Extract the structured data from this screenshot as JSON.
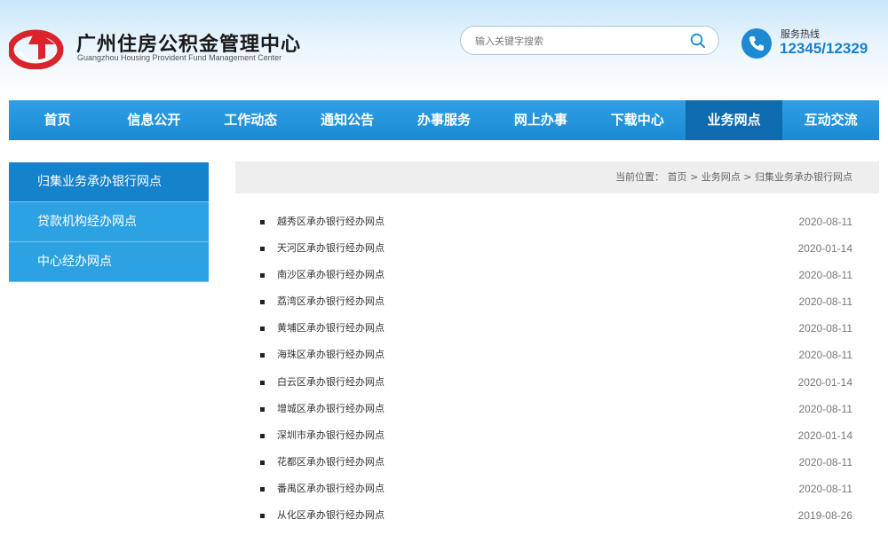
{
  "header": {
    "title": "广州住房公积金管理中心",
    "subtitle": "Guangzhou Housing Provident Fund Management Center",
    "logo_icon": "guangzhou-hpf-logo",
    "search": {
      "placeholder": "输入关键字搜索",
      "value": ""
    },
    "hotline": {
      "label": "服务热线",
      "number": "12345/12329"
    }
  },
  "colors": {
    "nav_blue": "#1b8ad4",
    "nav_active": "#0e6cae",
    "side_blue": "#2ca2e3",
    "side_active": "#1582cc",
    "logo_red": "#d8242a",
    "hotline_blue": "#1a7fcc"
  },
  "nav": {
    "items": [
      {
        "label": "首页"
      },
      {
        "label": "信息公开"
      },
      {
        "label": "工作动态"
      },
      {
        "label": "通知公告"
      },
      {
        "label": "办事服务"
      },
      {
        "label": "网上办事"
      },
      {
        "label": "下载中心"
      },
      {
        "label": "业务网点",
        "active": true
      },
      {
        "label": "互动交流"
      }
    ]
  },
  "sidebar": {
    "items": [
      {
        "label": "归集业务承办银行网点",
        "active": true
      },
      {
        "label": "贷款机构经办网点"
      },
      {
        "label": "中心经办网点"
      }
    ]
  },
  "breadcrumb": {
    "prefix": "当前位置：",
    "home": "首页",
    "sep": ">",
    "level1": "业务网点",
    "level2": "归集业务承办银行网点"
  },
  "list": {
    "items": [
      {
        "title": "越秀区承办银行经办网点",
        "date": "2020-08-11"
      },
      {
        "title": "天河区承办银行经办网点",
        "date": "2020-01-14"
      },
      {
        "title": "南沙区承办银行经办网点",
        "date": "2020-08-11"
      },
      {
        "title": "荔湾区承办银行经办网点",
        "date": "2020-08-11"
      },
      {
        "title": "黄埔区承办银行经办网点",
        "date": "2020-08-11"
      },
      {
        "title": "海珠区承办银行经办网点",
        "date": "2020-08-11"
      },
      {
        "title": "白云区承办银行经办网点",
        "date": "2020-01-14"
      },
      {
        "title": "增城区承办银行经办网点",
        "date": "2020-08-11"
      },
      {
        "title": "深圳市承办银行经办网点",
        "date": "2020-01-14"
      },
      {
        "title": "花都区承办银行经办网点",
        "date": "2020-08-11"
      },
      {
        "title": "番禺区承办银行经办网点",
        "date": "2020-08-11"
      },
      {
        "title": "从化区承办银行经办网点",
        "date": "2019-08-26"
      }
    ]
  }
}
